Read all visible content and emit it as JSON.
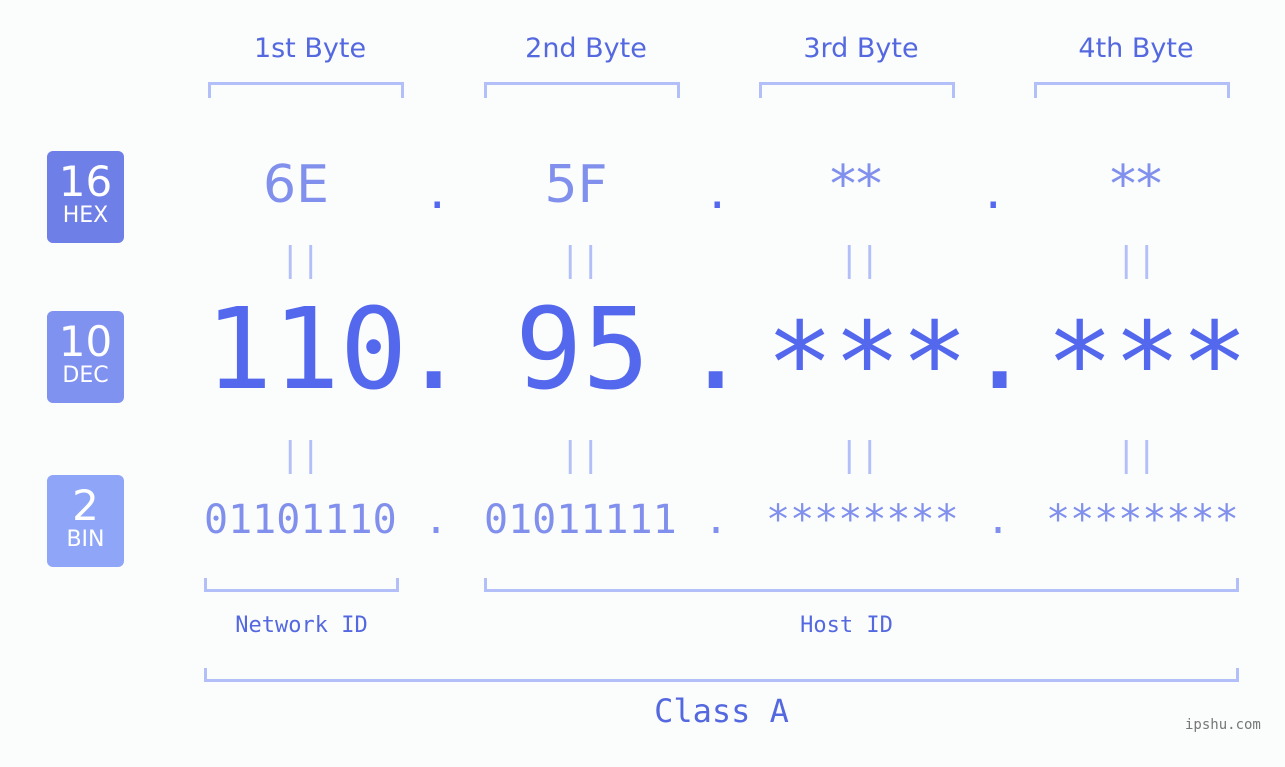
{
  "byte_headers": [
    "1st Byte",
    "2nd Byte",
    "3rd Byte",
    "4th Byte"
  ],
  "badges": [
    {
      "number": "16",
      "label": "HEX",
      "color": "#6f7fe8"
    },
    {
      "number": "10",
      "label": "DEC",
      "color": "#8092f0"
    },
    {
      "number": "2",
      "label": "BIN",
      "color": "#8fa6f8"
    }
  ],
  "hex": [
    "6E",
    "5F",
    "**",
    "**"
  ],
  "dec": [
    "110",
    "95",
    "***",
    "***"
  ],
  "bin": [
    "01101110",
    "01011111",
    "********",
    "********"
  ],
  "separator": ".",
  "equals": "||",
  "network_label": "Network ID",
  "host_label": "Host ID",
  "class_label": "Class A",
  "watermark": "ipshu.com",
  "colors": {
    "primary": "#5468ee",
    "secondary": "#8090ec",
    "bracket": "#b3bff8"
  }
}
